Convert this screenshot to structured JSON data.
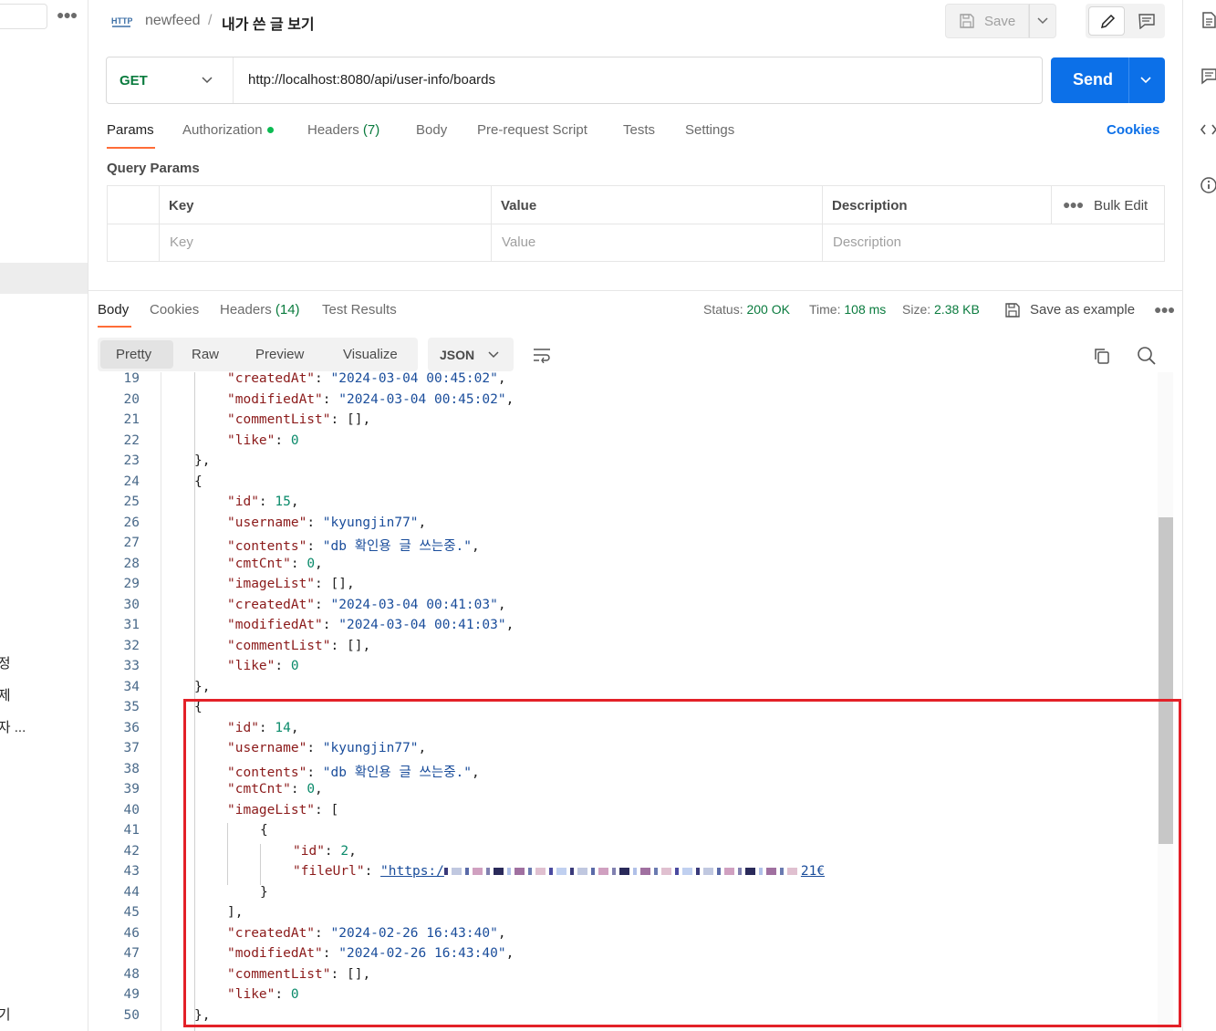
{
  "left_sidebar": {
    "items": [
      "수정",
      "삭제",
      "퇴자 ...",
      "리기"
    ]
  },
  "header": {
    "breadcrumb_parent": "newfeed",
    "breadcrumb_separator": "/",
    "breadcrumb_current": "내가 쓴 글 보기",
    "save_label": "Save"
  },
  "request": {
    "method": "GET",
    "url": "http://localhost:8080/api/user-info/boards",
    "send_label": "Send",
    "tabs": [
      {
        "label": "Params"
      },
      {
        "label": "Authorization"
      },
      {
        "label": "Headers",
        "count": "(7)"
      },
      {
        "label": "Body"
      },
      {
        "label": "Pre-request Script"
      },
      {
        "label": "Tests"
      },
      {
        "label": "Settings"
      }
    ],
    "cookies_label": "Cookies",
    "query_params_title": "Query Params",
    "columns": [
      "Key",
      "Value",
      "Description"
    ],
    "placeholders": [
      "Key",
      "Value",
      "Description"
    ],
    "bulk_edit": "Bulk Edit"
  },
  "response": {
    "tabs": [
      {
        "label": "Body"
      },
      {
        "label": "Cookies"
      },
      {
        "label": "Headers",
        "count": "(14)"
      },
      {
        "label": "Test Results"
      }
    ],
    "status_label": "Status:",
    "status_value": "200 OK",
    "time_label": "Time:",
    "time_value": "108 ms",
    "size_label": "Size:",
    "size_value": "2.38 KB",
    "save_example": "Save as example",
    "views": [
      "Pretty",
      "Raw",
      "Preview",
      "Visualize"
    ],
    "format": "JSON"
  },
  "code_lines": [
    {
      "n": "19",
      "indent": 2,
      "key": "createdAt",
      "val": "\"2024-03-04 00:45:02\"",
      "type": "s",
      "tail": ","
    },
    {
      "n": "20",
      "indent": 2,
      "key": "modifiedAt",
      "val": "\"2024-03-04 00:45:02\"",
      "type": "s",
      "tail": ","
    },
    {
      "n": "21",
      "indent": 2,
      "key": "commentList",
      "val": "[]",
      "type": "p",
      "tail": ","
    },
    {
      "n": "22",
      "indent": 2,
      "key": "like",
      "val": "0",
      "type": "n",
      "tail": ""
    },
    {
      "n": "23",
      "indent": 1,
      "raw": "},"
    },
    {
      "n": "24",
      "indent": 1,
      "raw": "{"
    },
    {
      "n": "25",
      "indent": 2,
      "key": "id",
      "val": "15",
      "type": "n",
      "tail": ","
    },
    {
      "n": "26",
      "indent": 2,
      "key": "username",
      "val": "\"kyungjin77\"",
      "type": "s",
      "tail": ","
    },
    {
      "n": "27",
      "indent": 2,
      "key": "contents",
      "val": "\"db 확인용 글 쓰는중.\"",
      "type": "s",
      "tail": ","
    },
    {
      "n": "28",
      "indent": 2,
      "key": "cmtCnt",
      "val": "0",
      "type": "n",
      "tail": ","
    },
    {
      "n": "29",
      "indent": 2,
      "key": "imageList",
      "val": "[]",
      "type": "p",
      "tail": ","
    },
    {
      "n": "30",
      "indent": 2,
      "key": "createdAt",
      "val": "\"2024-03-04 00:41:03\"",
      "type": "s",
      "tail": ","
    },
    {
      "n": "31",
      "indent": 2,
      "key": "modifiedAt",
      "val": "\"2024-03-04 00:41:03\"",
      "type": "s",
      "tail": ","
    },
    {
      "n": "32",
      "indent": 2,
      "key": "commentList",
      "val": "[]",
      "type": "p",
      "tail": ","
    },
    {
      "n": "33",
      "indent": 2,
      "key": "like",
      "val": "0",
      "type": "n",
      "tail": ""
    },
    {
      "n": "34",
      "indent": 1,
      "raw": "},"
    },
    {
      "n": "35",
      "indent": 1,
      "raw": "{"
    },
    {
      "n": "36",
      "indent": 2,
      "key": "id",
      "val": "14",
      "type": "n",
      "tail": ","
    },
    {
      "n": "37",
      "indent": 2,
      "key": "username",
      "val": "\"kyungjin77\"",
      "type": "s",
      "tail": ","
    },
    {
      "n": "38",
      "indent": 2,
      "key": "contents",
      "val": "\"db 확인용 글 쓰는중.\"",
      "type": "s",
      "tail": ","
    },
    {
      "n": "39",
      "indent": 2,
      "key": "cmtCnt",
      "val": "0",
      "type": "n",
      "tail": ","
    },
    {
      "n": "40",
      "indent": 2,
      "key": "imageList",
      "val": "[",
      "type": "p",
      "tail": ""
    },
    {
      "n": "41",
      "indent": 3,
      "raw": "{"
    },
    {
      "n": "42",
      "indent": 4,
      "key": "id",
      "val": "2",
      "type": "n",
      "tail": ","
    },
    {
      "n": "43",
      "indent": 4,
      "key": "fileUrl",
      "val": "\"https:/",
      "type": "url",
      "tail": "",
      "blurred": true,
      "suffix": "21€"
    },
    {
      "n": "44",
      "indent": 3,
      "raw": "}"
    },
    {
      "n": "45",
      "indent": 2,
      "raw": "],"
    },
    {
      "n": "46",
      "indent": 2,
      "key": "createdAt",
      "val": "\"2024-02-26 16:43:40\"",
      "type": "s",
      "tail": ","
    },
    {
      "n": "47",
      "indent": 2,
      "key": "modifiedAt",
      "val": "\"2024-02-26 16:43:40\"",
      "type": "s",
      "tail": ","
    },
    {
      "n": "48",
      "indent": 2,
      "key": "commentList",
      "val": "[]",
      "type": "p",
      "tail": ","
    },
    {
      "n": "49",
      "indent": 2,
      "key": "like",
      "val": "0",
      "type": "n",
      "tail": ""
    },
    {
      "n": "50",
      "indent": 1,
      "raw": "},"
    }
  ]
}
